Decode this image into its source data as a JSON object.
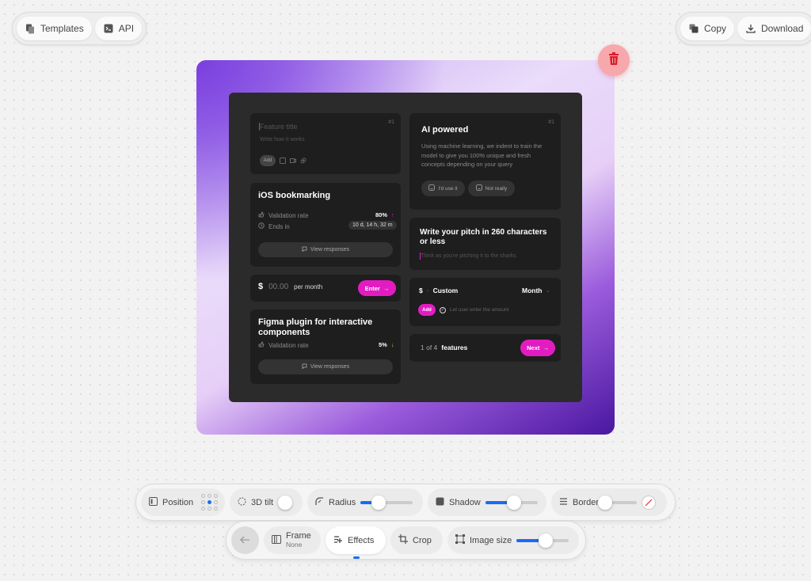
{
  "top_left": {
    "templates": {
      "label": "Templates",
      "icon": "templates-icon"
    },
    "api": {
      "label": "API",
      "icon": "terminal-icon"
    }
  },
  "top_right": {
    "copy": {
      "label": "Copy",
      "icon": "copy-icon"
    },
    "download": {
      "label": "Download",
      "icon": "download-icon"
    }
  },
  "colors": {
    "accent": "#e31cc2",
    "toolbar_accent": "#1a6cf0",
    "delete": "#f7a8ad"
  },
  "preview": {
    "feature_card": {
      "title_placeholder": "Feature title",
      "desc_placeholder": "Write how it works",
      "add_label": "Add",
      "number": "#1"
    },
    "ios_card": {
      "title": "iOS bookmarking",
      "validation_label": "Validation rate",
      "validation_value": "80%",
      "ends_label": "Ends in",
      "ends_value": "10 d, 14 h, 32 m",
      "responses_label": "View responses"
    },
    "price_card": {
      "currency": "$",
      "placeholder": "00.00",
      "suffix": "per month",
      "enter_label": "Enter"
    },
    "figma_card": {
      "title": "Figma plugin for interactive components",
      "validation_label": "Validation rate",
      "validation_value": "5%",
      "responses_label": "View responses"
    },
    "ai_card": {
      "title": "AI powered",
      "number": "#1",
      "description": "Using machine learning, we indent to train the model to give you 100% unique and fresh concepts depending on your query",
      "use_label": "I'd use it",
      "not_label": "Not really"
    },
    "pitch_card": {
      "title": "Write your pitch in 260 characters or less",
      "placeholder": "Think as you're pitching it to the sharks"
    },
    "custom_card": {
      "currency": "$",
      "dot": "·",
      "custom_label": "Custom",
      "period_label": "Month",
      "add_label": "Add",
      "checkbox_label": "Let user enter the amount"
    },
    "features_card": {
      "count_prefix": "1 of 4",
      "count_suffix": "features",
      "next_label": "Next"
    }
  },
  "toolbar": {
    "position": {
      "label": "Position"
    },
    "tilt": {
      "label": "3D tilt"
    },
    "radius": {
      "label": "Radius",
      "value": 0.35
    },
    "shadow": {
      "label": "Shadow",
      "value": 0.55
    },
    "border": {
      "label": "Border",
      "value": 0.05
    },
    "frame": {
      "label": "Frame",
      "sub": "None"
    },
    "effects": {
      "label": "Effects"
    },
    "crop": {
      "label": "Crop"
    },
    "image_size": {
      "label": "Image size",
      "value": 0.55
    }
  }
}
